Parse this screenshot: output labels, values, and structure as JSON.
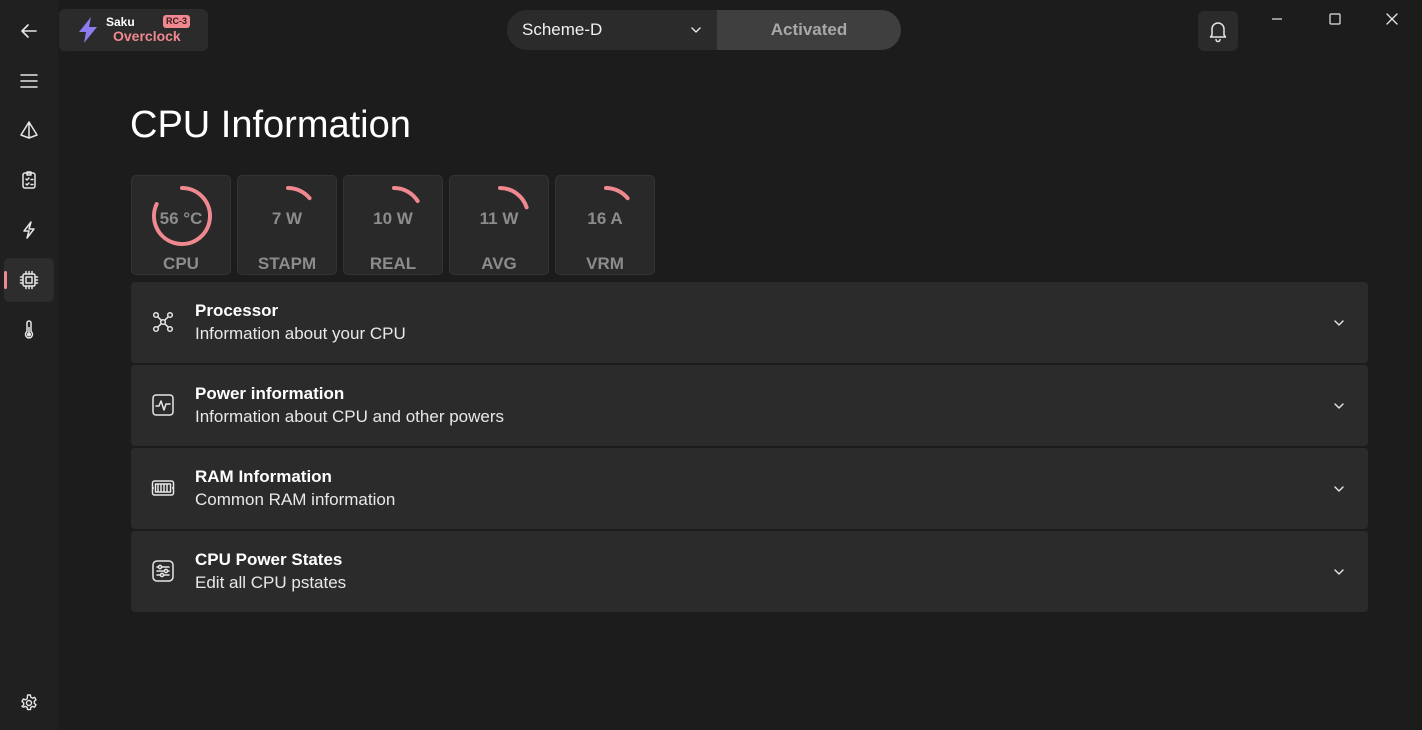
{
  "app": {
    "name_line1": "Saku",
    "name_line2": "Overclock",
    "badge": "RC-3",
    "accent": "#f08890",
    "bolt_color": "#8c7cf0"
  },
  "header": {
    "scheme_value": "Scheme-D",
    "activated_label": "Activated"
  },
  "nav": {
    "items": [
      {
        "icon": "back-arrow-icon"
      },
      {
        "icon": "hamburger-menu-icon"
      },
      {
        "icon": "pyramid-icon"
      },
      {
        "icon": "clipboard-checklist-icon"
      },
      {
        "icon": "lightning-icon"
      },
      {
        "icon": "cpu-chip-icon",
        "active": true
      },
      {
        "icon": "thermometer-icon"
      },
      {
        "icon": "settings-gear-icon"
      }
    ]
  },
  "page": {
    "title": "CPU Information"
  },
  "gauges": [
    {
      "value": "56 °C",
      "label": "CPU",
      "fraction": 0.82
    },
    {
      "value": "7 W",
      "label": "STAPM",
      "fraction": 0.14
    },
    {
      "value": "10 W",
      "label": "REAL",
      "fraction": 0.16
    },
    {
      "value": "11 W",
      "label": "AVG",
      "fraction": 0.2
    },
    {
      "value": "16 A",
      "label": "VRM",
      "fraction": 0.14
    }
  ],
  "sections": [
    {
      "icon": "network-nodes-icon",
      "title": "Processor",
      "subtitle": "Information about your CPU"
    },
    {
      "icon": "pulse-monitor-icon",
      "title": "Power information",
      "subtitle": "Information about CPU and other powers"
    },
    {
      "icon": "ram-module-icon",
      "title": "RAM Information",
      "subtitle": "Common RAM information"
    },
    {
      "icon": "sliders-panel-icon",
      "title": "CPU Power States",
      "subtitle": "Edit all CPU pstates"
    }
  ]
}
